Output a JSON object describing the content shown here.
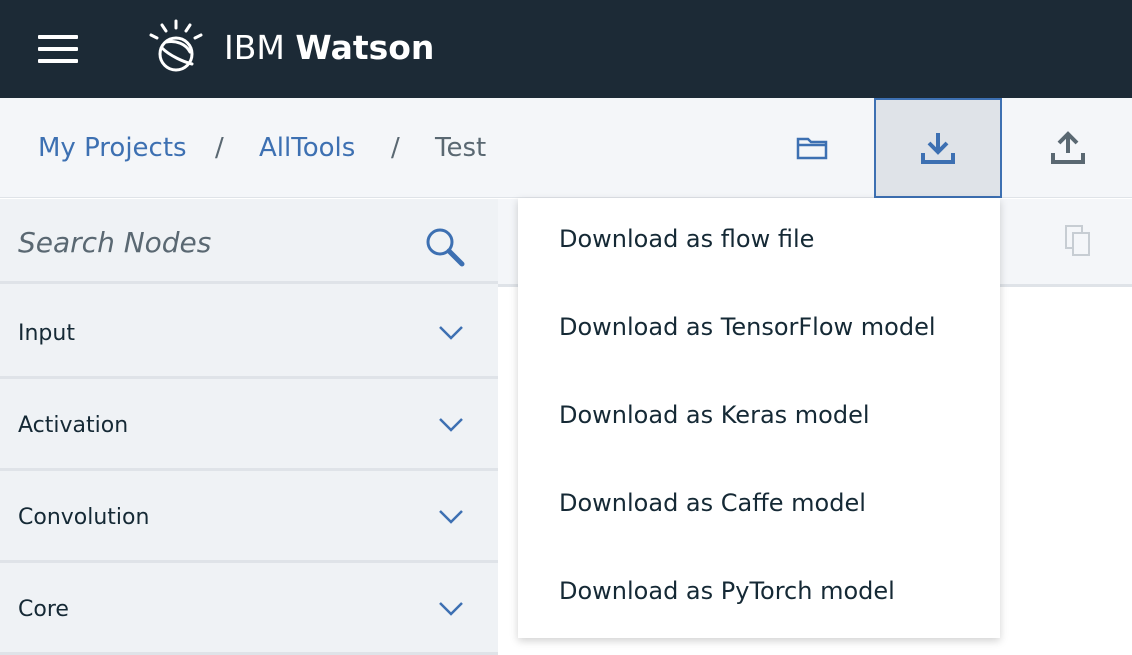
{
  "header": {
    "brand_prefix": "IBM",
    "brand_name": "Watson",
    "background": "#1c2a36"
  },
  "breadcrumb": {
    "items": [
      {
        "label": "My Projects"
      },
      {
        "label": "AllTools"
      },
      {
        "label": "Test"
      }
    ],
    "separator": "/"
  },
  "toolbar": {
    "icons": [
      "folder-icon",
      "download-icon",
      "upload-icon"
    ],
    "active": "download-icon",
    "accent": "#3d70b2"
  },
  "search": {
    "placeholder": "Search Nodes"
  },
  "categories": [
    {
      "label": "Input"
    },
    {
      "label": "Activation"
    },
    {
      "label": "Convolution"
    },
    {
      "label": "Core"
    }
  ],
  "download_menu": {
    "items": [
      {
        "label": "Download as flow file"
      },
      {
        "label": "Download as TensorFlow model"
      },
      {
        "label": "Download as Keras model"
      },
      {
        "label": "Download as Caffe model"
      },
      {
        "label": "Download as PyTorch model"
      }
    ]
  }
}
